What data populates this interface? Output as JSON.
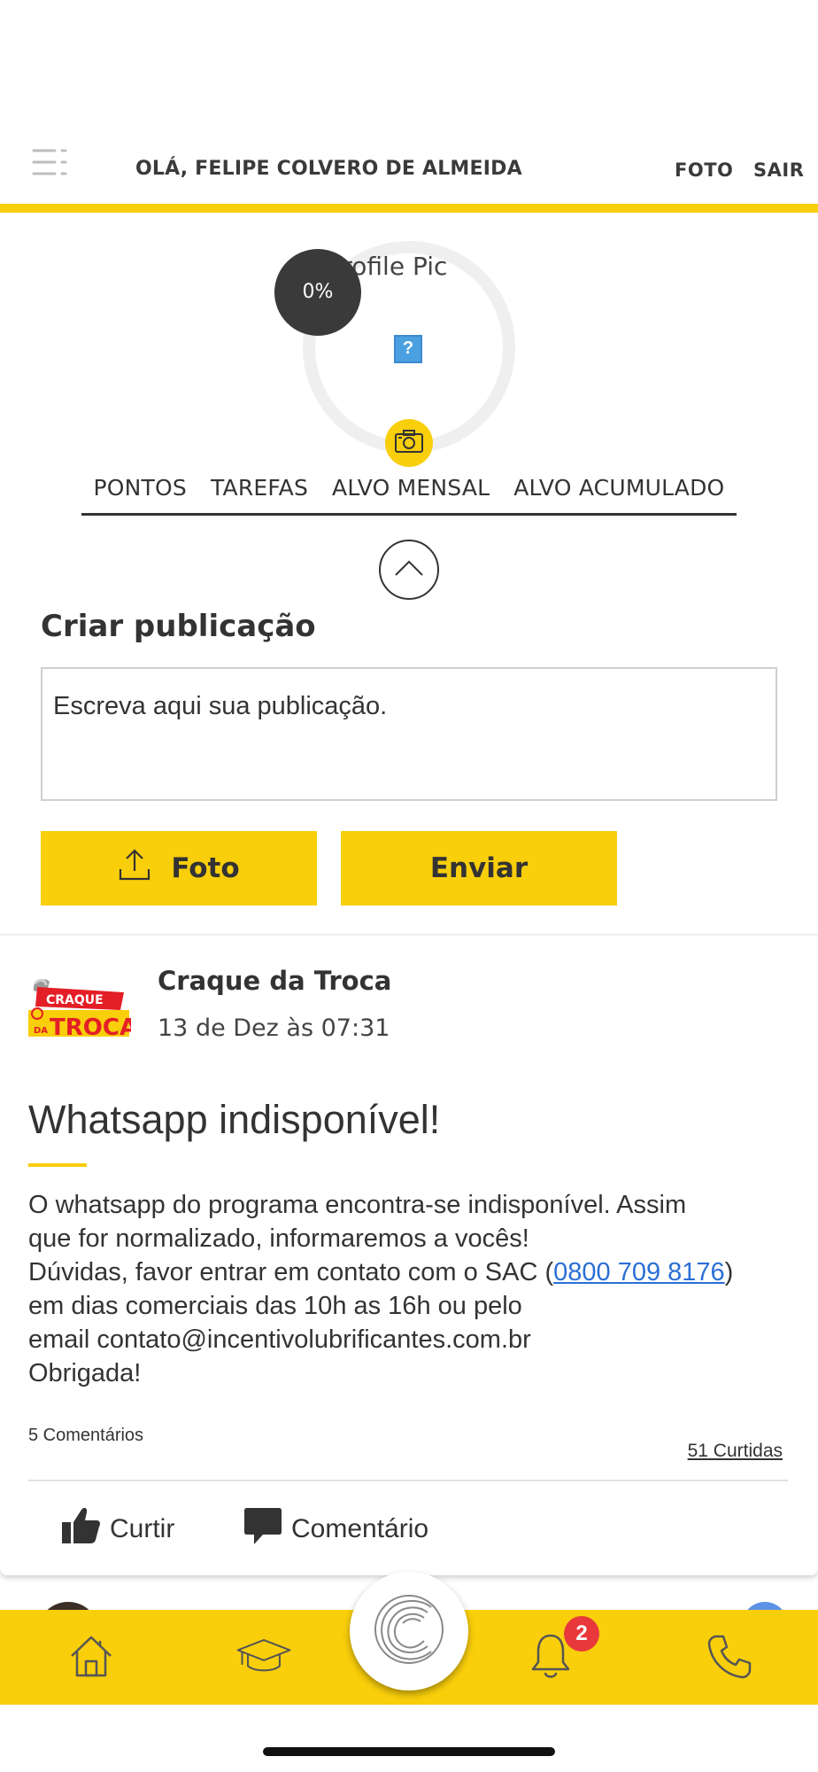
{
  "header": {
    "greeting": "OLÁ, FELIPE COLVERO DE ALMEIDA",
    "photo_link": "FOTO",
    "logout_link": "SAIR"
  },
  "profile": {
    "image_alt_text": "Profile Pic",
    "progress_label": "0%",
    "progress_percent": 0,
    "broken_image_glyph": "?"
  },
  "stats_tabs": [
    "PONTOS",
    "TAREFAS",
    "ALVO MENSAL",
    "ALVO ACUMULADO"
  ],
  "create_post": {
    "title": "Criar publicação",
    "placeholder": "Escreva aqui sua publicação.",
    "photo_button": "Foto",
    "send_button": "Enviar"
  },
  "post": {
    "logo_top": "CRAQUE",
    "logo_bottom_small": "DA",
    "logo_bottom": "TROCA",
    "author": "Craque da Troca",
    "date": "13 de Dez às 07:31",
    "title": "Whatsapp indisponível!",
    "body_line1": "O whatsapp do programa encontra-se indisponível. Assim",
    "body_line2": "que for normalizado, informaremos a vocês!",
    "body_line3_pre": "Dúvidas, favor entrar em contato com o SAC (",
    "body_phone": "0800 709 8176",
    "body_line3_post": ")",
    "body_line4": "em dias comerciais das 10h as 16h ou pelo",
    "body_line5": "email contato@incentivolubrificantes.com.br",
    "body_line6": "Obrigada!",
    "comments_count": "5 Comentários",
    "likes_count": "51 Curtidas",
    "like_action": "Curtir",
    "comment_action": "Comentário"
  },
  "bottom_nav": {
    "items": [
      "home-icon",
      "graduation-cap-icon",
      "center-logo-icon",
      "bell-icon",
      "phone-icon"
    ],
    "notification_badge": "2"
  },
  "colors": {
    "accent": "#f9ce0b",
    "dark": "#3a3a3a",
    "link": "#2a6fd6",
    "badge": "#e8383c"
  }
}
